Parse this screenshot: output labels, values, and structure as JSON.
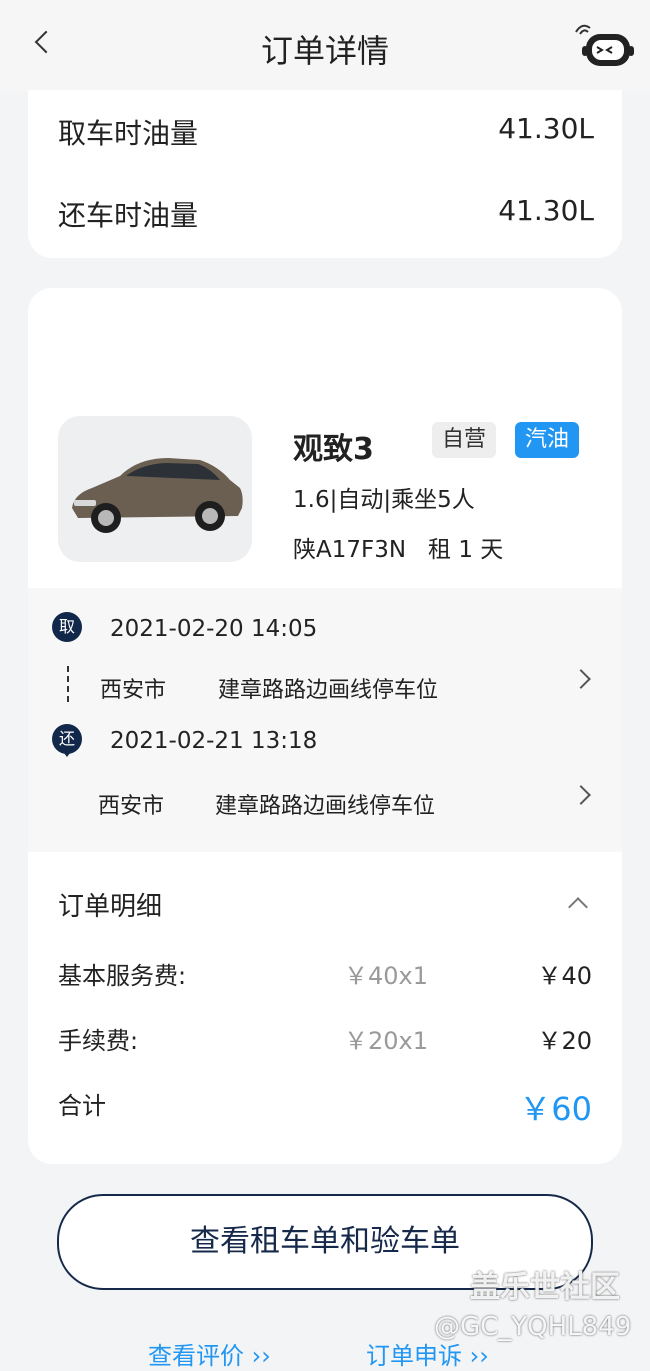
{
  "header": {
    "title": "订单详情"
  },
  "fuel": {
    "pickup_label": "取车时油量",
    "pickup_value": "41.30L",
    "return_label": "还车时油量",
    "return_value": "41.30L"
  },
  "car": {
    "name": "观致3",
    "badge_self": "自营",
    "badge_fuel": "汽油",
    "spec": "1.6|自动|乘坐5人",
    "plate": "陕A17F3N",
    "rent_days": "租 1 天"
  },
  "route": {
    "pickup_tag": "取",
    "pickup_time": "2021-02-20 14:05",
    "pickup_city": "西安市",
    "pickup_address": "建章路路边画线停车位",
    "return_tag": "还",
    "return_time": "2021-02-21 13:18",
    "return_city": "西安市",
    "return_address": "建章路路边画线停车位"
  },
  "detail": {
    "title": "订单明细",
    "fees": [
      {
        "label": "基本服务费:",
        "unit": "￥40x1",
        "total": "￥40"
      },
      {
        "label": "手续费:",
        "unit": "￥20x1",
        "total": "￥20"
      }
    ],
    "sum_label": "合计",
    "sum_value": "￥60"
  },
  "actions": {
    "check_button": "查看租车单和验车单",
    "review_link": "查看评价 ››",
    "appeal_link": "订单申诉 ››"
  },
  "watermark": {
    "line1": "盖乐世社区",
    "line2": "@GC_YQHL849"
  },
  "colors": {
    "accent": "#2196f3",
    "navy": "#16294a"
  }
}
